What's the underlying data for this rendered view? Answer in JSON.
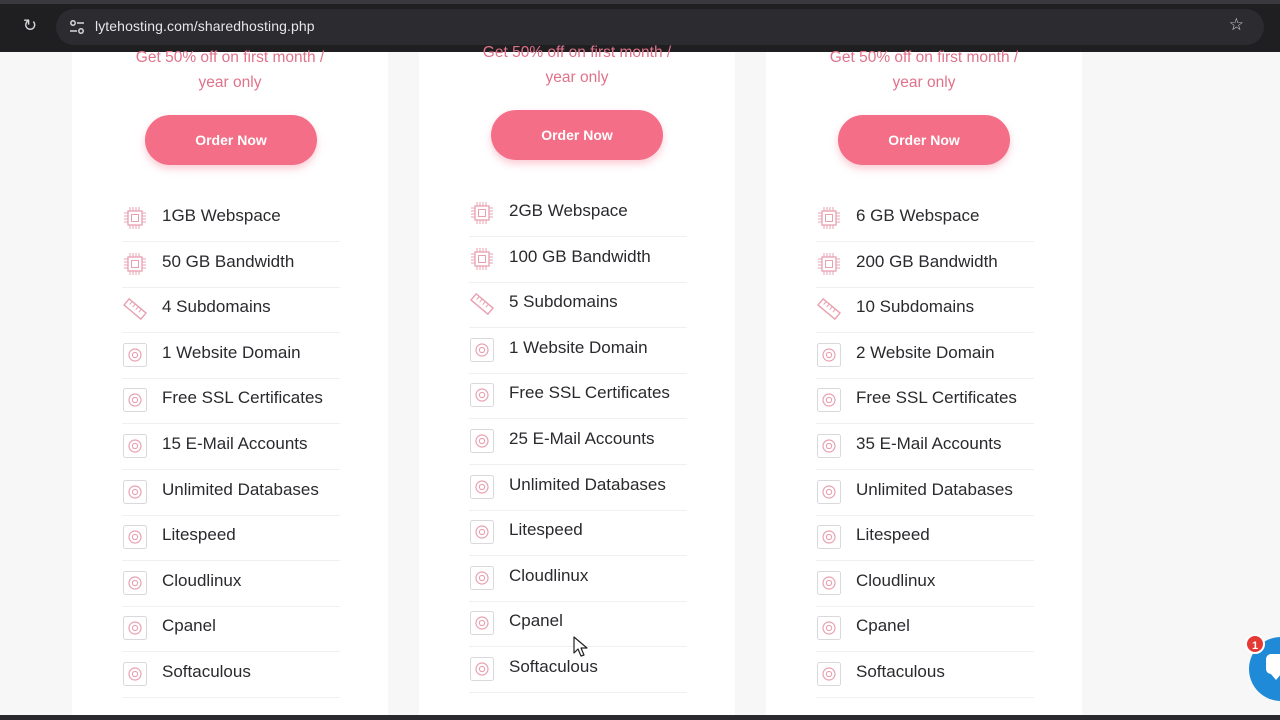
{
  "browser": {
    "url": "lytehosting.com/sharedhosting.php"
  },
  "plans": [
    {
      "promo_line1": "Get 50% off on first month /",
      "promo_line2": "year only",
      "order_label": "Order Now",
      "features": [
        {
          "icon": "chip-icon",
          "label": "1GB Webspace"
        },
        {
          "icon": "chip-icon",
          "label": "50 GB Bandwidth"
        },
        {
          "icon": "ruler-icon",
          "label": "4 Subdomains"
        },
        {
          "icon": "target-icon",
          "label": "1 Website Domain"
        },
        {
          "icon": "target-icon",
          "label": "Free SSL Certificates"
        },
        {
          "icon": "target-icon",
          "label": "15 E-Mail Accounts"
        },
        {
          "icon": "target-icon",
          "label": "Unlimited Databases"
        },
        {
          "icon": "target-icon",
          "label": "Litespeed"
        },
        {
          "icon": "target-icon",
          "label": "Cloudlinux"
        },
        {
          "icon": "target-icon",
          "label": "Cpanel"
        },
        {
          "icon": "target-icon",
          "label": "Softaculous"
        }
      ]
    },
    {
      "promo_line1": "Get 50% off on first month /",
      "promo_line2": "year only",
      "order_label": "Order Now",
      "features": [
        {
          "icon": "chip-icon",
          "label": "2GB Webspace"
        },
        {
          "icon": "chip-icon",
          "label": "100 GB Bandwidth"
        },
        {
          "icon": "ruler-icon",
          "label": "5 Subdomains"
        },
        {
          "icon": "target-icon",
          "label": "1 Website Domain"
        },
        {
          "icon": "target-icon",
          "label": "Free SSL Certificates"
        },
        {
          "icon": "target-icon",
          "label": "25 E-Mail Accounts"
        },
        {
          "icon": "target-icon",
          "label": "Unlimited Databases"
        },
        {
          "icon": "target-icon",
          "label": "Litespeed"
        },
        {
          "icon": "target-icon",
          "label": "Cloudlinux"
        },
        {
          "icon": "target-icon",
          "label": "Cpanel"
        },
        {
          "icon": "target-icon",
          "label": "Softaculous"
        }
      ]
    },
    {
      "promo_line1": "Get 50% off on first month /",
      "promo_line2": "year only",
      "order_label": "Order Now",
      "features": [
        {
          "icon": "chip-icon",
          "label": "6 GB Webspace"
        },
        {
          "icon": "chip-icon",
          "label": "200 GB Bandwidth"
        },
        {
          "icon": "ruler-icon",
          "label": "10 Subdomains"
        },
        {
          "icon": "target-icon",
          "label": "2 Website Domain"
        },
        {
          "icon": "target-icon",
          "label": "Free SSL Certificates"
        },
        {
          "icon": "target-icon",
          "label": "35 E-Mail Accounts"
        },
        {
          "icon": "target-icon",
          "label": "Unlimited Databases"
        },
        {
          "icon": "target-icon",
          "label": "Litespeed"
        },
        {
          "icon": "target-icon",
          "label": "Cloudlinux"
        },
        {
          "icon": "target-icon",
          "label": "Cpanel"
        },
        {
          "icon": "target-icon",
          "label": "Softaculous"
        }
      ]
    }
  ],
  "chat_widget": {
    "badge_count": "1"
  },
  "colors": {
    "accent": "#f36e86",
    "promo_text": "#e0728a",
    "icon_stroke": "#e8a0b0",
    "chat": "#1f8ad8"
  }
}
